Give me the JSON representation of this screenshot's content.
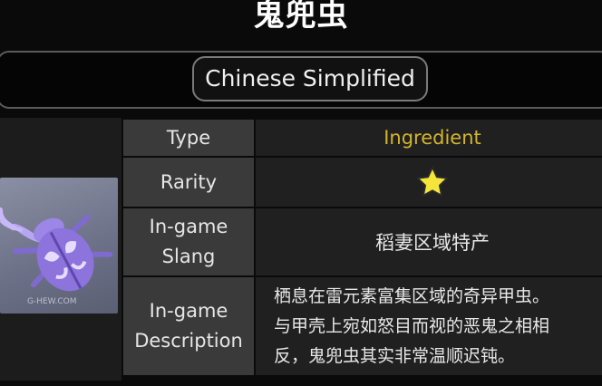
{
  "header": {
    "title": "鬼兜虫"
  },
  "language": {
    "selected": "Chinese Simplified"
  },
  "item": {
    "watermark": "G-HEW.COM"
  },
  "table": {
    "type_label": "Type",
    "type_value": "Ingredient",
    "rarity_label": "Rarity",
    "rarity_stars": 1,
    "slang_label_1": "In-game",
    "slang_label_2": "Slang",
    "slang_value": "稻妻区域特产",
    "desc_label_1": "In-game",
    "desc_label_2": "Description",
    "desc_line_1": "栖息在雷元素富集区域的奇异甲虫。",
    "desc_line_2": "与甲壳上宛如怒目而视的恶鬼之相相",
    "desc_line_3": "反，鬼兜虫其实非常温顺迟钝。"
  },
  "colors": {
    "type_value": "#d4b52c",
    "star": "#f5e43a"
  }
}
